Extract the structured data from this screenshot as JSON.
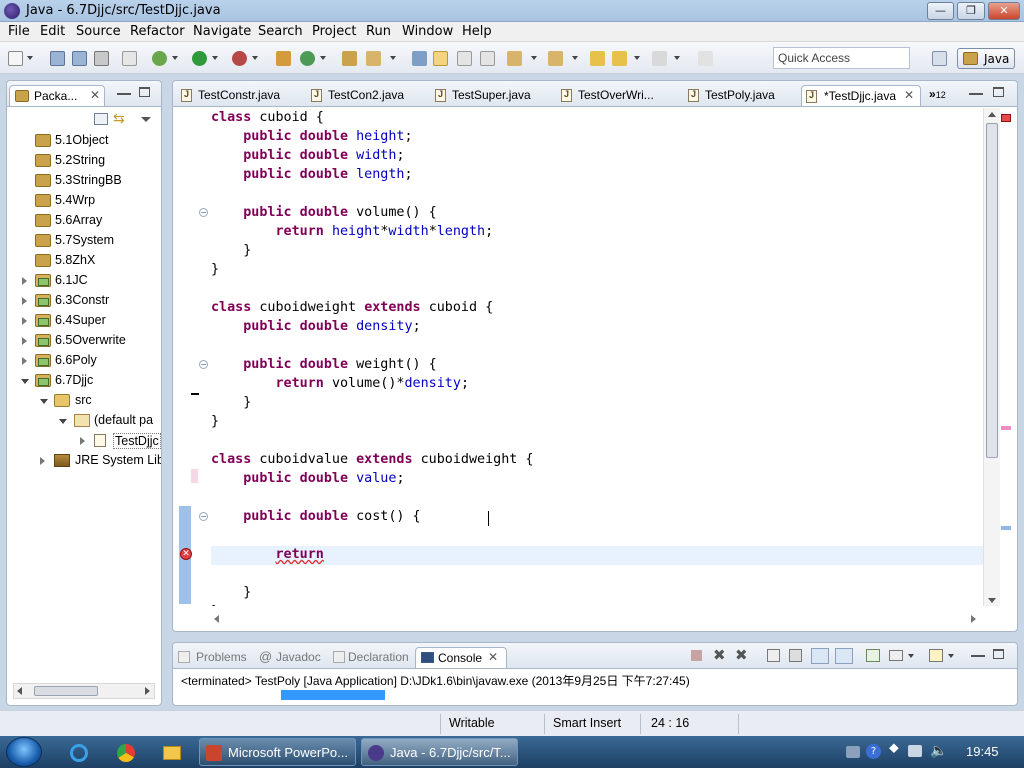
{
  "window": {
    "title": "Java - 6.7Djjc/src/TestDjjc.java",
    "minimize_glyph": "—",
    "maximize_glyph": "❐",
    "close_glyph": "✕"
  },
  "menu": [
    "File",
    "Edit",
    "Source",
    "Refactor",
    "Navigate",
    "Search",
    "Project",
    "Run",
    "Window",
    "Help"
  ],
  "toolbar": {
    "quick_access_placeholder": "Quick Access",
    "perspective_label": "Java"
  },
  "package_explorer": {
    "tab_label": "Packa...",
    "tree": [
      {
        "label": "5.1Object",
        "icon": "package-icon"
      },
      {
        "label": "5.2String",
        "icon": "package-icon"
      },
      {
        "label": "5.3StringBB",
        "icon": "package-icon"
      },
      {
        "label": "5.4Wrp",
        "icon": "package-icon"
      },
      {
        "label": "5.6Array",
        "icon": "package-icon"
      },
      {
        "label": "5.7System",
        "icon": "package-icon"
      },
      {
        "label": "5.8ZhX",
        "icon": "package-icon"
      },
      {
        "label": "6.1JC",
        "icon": "project-icon"
      },
      {
        "label": "6.3Constr",
        "icon": "project-icon"
      },
      {
        "label": "6.4Super",
        "icon": "project-icon"
      },
      {
        "label": "6.5Overwrite",
        "icon": "project-icon"
      },
      {
        "label": "6.6Poly",
        "icon": "project-icon"
      },
      {
        "label": "6.7Djjc",
        "icon": "project-icon"
      },
      {
        "label": "src",
        "icon": "source-folder-icon"
      },
      {
        "label": "(default pa",
        "icon": "default-package-icon"
      },
      {
        "label": "TestDjjc",
        "icon": "java-file-icon"
      },
      {
        "label": "JRE System Lib",
        "icon": "jre-library-icon"
      }
    ]
  },
  "editor": {
    "tabs": [
      {
        "label": "TestConstr.java"
      },
      {
        "label": "TestCon2.java"
      },
      {
        "label": "TestSuper.java"
      },
      {
        "label": "TestOverWri..."
      },
      {
        "label": "TestPoly.java"
      },
      {
        "label": "*TestDjjc.java"
      }
    ],
    "overflow_count": "12",
    "code_lines": [
      [
        {
          "t": "class ",
          "c": "kw"
        },
        {
          "t": "cuboid {",
          "c": ""
        }
      ],
      [
        {
          "t": "    ",
          "c": ""
        },
        {
          "t": "public double ",
          "c": "kw"
        },
        {
          "t": "height",
          "c": "fld"
        },
        {
          "t": ";",
          "c": ""
        }
      ],
      [
        {
          "t": "    ",
          "c": ""
        },
        {
          "t": "public double ",
          "c": "kw"
        },
        {
          "t": "width",
          "c": "fld"
        },
        {
          "t": ";",
          "c": ""
        }
      ],
      [
        {
          "t": "    ",
          "c": ""
        },
        {
          "t": "public double ",
          "c": "kw"
        },
        {
          "t": "length",
          "c": "fld"
        },
        {
          "t": ";",
          "c": ""
        }
      ],
      [
        {
          "t": "",
          "c": ""
        }
      ],
      [
        {
          "t": "    ",
          "c": ""
        },
        {
          "t": "public double ",
          "c": "kw"
        },
        {
          "t": "volume() {",
          "c": ""
        }
      ],
      [
        {
          "t": "        ",
          "c": ""
        },
        {
          "t": "return ",
          "c": "kw"
        },
        {
          "t": "height",
          "c": "fld"
        },
        {
          "t": "*",
          "c": ""
        },
        {
          "t": "width",
          "c": "fld"
        },
        {
          "t": "*",
          "c": ""
        },
        {
          "t": "length",
          "c": "fld"
        },
        {
          "t": ";",
          "c": ""
        }
      ],
      [
        {
          "t": "    }",
          "c": ""
        }
      ],
      [
        {
          "t": "}",
          "c": ""
        }
      ],
      [
        {
          "t": "",
          "c": ""
        }
      ],
      [
        {
          "t": "class ",
          "c": "kw"
        },
        {
          "t": "cuboidweight ",
          "c": ""
        },
        {
          "t": "extends ",
          "c": "kw"
        },
        {
          "t": "cuboid {",
          "c": ""
        }
      ],
      [
        {
          "t": "    ",
          "c": ""
        },
        {
          "t": "public double ",
          "c": "kw"
        },
        {
          "t": "density",
          "c": "fld"
        },
        {
          "t": ";",
          "c": ""
        }
      ],
      [
        {
          "t": "",
          "c": ""
        }
      ],
      [
        {
          "t": "    ",
          "c": ""
        },
        {
          "t": "public double ",
          "c": "kw"
        },
        {
          "t": "weight() {",
          "c": ""
        }
      ],
      [
        {
          "t": "        ",
          "c": ""
        },
        {
          "t": "return ",
          "c": "kw"
        },
        {
          "t": "volume()*",
          "c": ""
        },
        {
          "t": "density",
          "c": "fld"
        },
        {
          "t": ";",
          "c": ""
        }
      ],
      [
        {
          "t": "    }",
          "c": ""
        }
      ],
      [
        {
          "t": "}",
          "c": ""
        }
      ],
      [
        {
          "t": "",
          "c": ""
        }
      ],
      [
        {
          "t": "class ",
          "c": "kw"
        },
        {
          "t": "cuboidvalue ",
          "c": ""
        },
        {
          "t": "extends ",
          "c": "kw"
        },
        {
          "t": "cuboidweight {",
          "c": ""
        }
      ],
      [
        {
          "t": "    ",
          "c": ""
        },
        {
          "t": "public double ",
          "c": "kw"
        },
        {
          "t": "value",
          "c": "fld"
        },
        {
          "t": ";",
          "c": ""
        }
      ],
      [
        {
          "t": "",
          "c": ""
        }
      ],
      [
        {
          "t": "    ",
          "c": ""
        },
        {
          "t": "public double ",
          "c": "kw"
        },
        {
          "t": "cost() {",
          "c": ""
        }
      ],
      [
        {
          "t": "",
          "c": ""
        }
      ],
      [
        {
          "t": "        ",
          "c": ""
        },
        {
          "t": "return",
          "c": "err"
        }
      ],
      [
        {
          "t": "",
          "c": ""
        }
      ],
      [
        {
          "t": "    }",
          "c": ""
        }
      ],
      [
        {
          "t": "}",
          "c": ""
        }
      ]
    ]
  },
  "console": {
    "tabs": [
      "Problems",
      "Javadoc",
      "Declaration",
      "Console"
    ],
    "status_line": "<terminated> TestPoly [Java Application] D:\\JDk1.6\\bin\\javaw.exe (2013年9月25日 下午7:27:45)"
  },
  "statusbar": {
    "mode": "Writable",
    "insert": "Smart Insert",
    "position": "24 : 16"
  },
  "taskbar": {
    "items": [
      "Microsoft PowerPo...",
      "Java - 6.7Djjc/src/T..."
    ],
    "clock": "19:45"
  },
  "colors": {
    "keyword": "#7f0055",
    "field": "#0000c0",
    "current_line": "#e8f2fe",
    "error": "#e03030"
  }
}
